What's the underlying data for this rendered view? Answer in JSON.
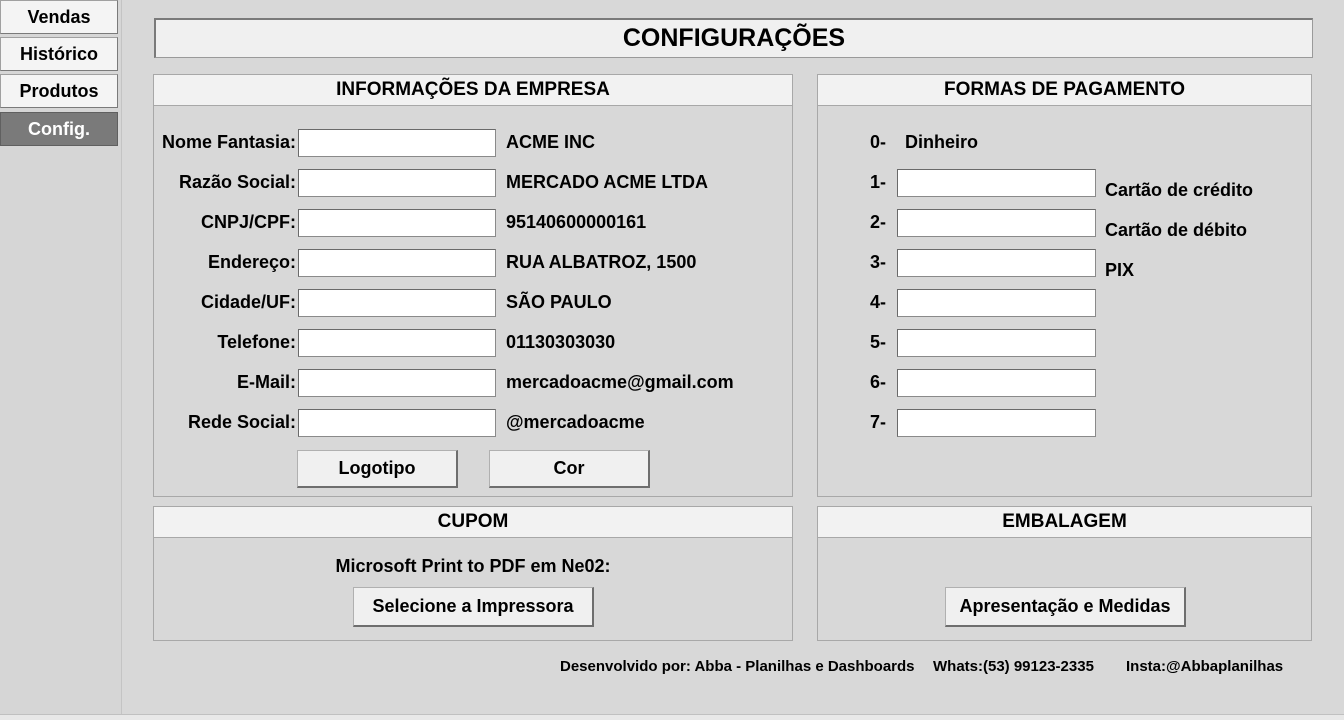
{
  "nav": {
    "vendas": "Vendas",
    "historico": "Histórico",
    "produtos": "Produtos",
    "config": "Config."
  },
  "title": "CONFIGURAÇÕES",
  "empresa": {
    "header": "INFORMAÇÕES DA EMPRESA",
    "fields": [
      {
        "label": "Nome Fantasia:",
        "input": "",
        "value": "ACME INC"
      },
      {
        "label": "Razão Social:",
        "input": "",
        "value": "MERCADO ACME LTDA"
      },
      {
        "label": "CNPJ/CPF:",
        "input": "",
        "value": "95140600000161"
      },
      {
        "label": "Endereço:",
        "input": "",
        "value": "RUA ALBATROZ, 1500"
      },
      {
        "label": "Cidade/UF:",
        "input": "",
        "value": "SÃO PAULO"
      },
      {
        "label": "Telefone:",
        "input": "",
        "value": "01130303030"
      },
      {
        "label": "E-Mail:",
        "input": "",
        "value": "mercadoacme@gmail.com"
      },
      {
        "label": "Rede Social:",
        "input": "",
        "value": "@mercadoacme"
      }
    ],
    "logo_button": "Logotipo",
    "color_button": "Cor"
  },
  "pagamento": {
    "header": "FORMAS DE PAGAMENTO",
    "fixed": {
      "num": "0-",
      "name": "Dinheiro"
    },
    "methods": [
      {
        "num": "1-",
        "input": "",
        "name": "Cartão de crédito"
      },
      {
        "num": "2-",
        "input": "",
        "name": "Cartão de débito"
      },
      {
        "num": "3-",
        "input": "",
        "name": "PIX"
      },
      {
        "num": "4-",
        "input": "",
        "name": ""
      },
      {
        "num": "5-",
        "input": "",
        "name": ""
      },
      {
        "num": "6-",
        "input": "",
        "name": ""
      },
      {
        "num": "7-",
        "input": "",
        "name": ""
      }
    ]
  },
  "cupom": {
    "header": "CUPOM",
    "printer_label": "Microsoft Print to PDF em Ne02:",
    "select_button": "Selecione a Impressora"
  },
  "embalagem": {
    "header": "EMBALAGEM",
    "button": "Apresentação e Medidas"
  },
  "footer": {
    "dev": "Desenvolvido por: Abba - Planilhas e Dashboards",
    "whats": "Whats:(53) 99123-2335",
    "insta": "Insta:@Abbaplanilhas"
  }
}
